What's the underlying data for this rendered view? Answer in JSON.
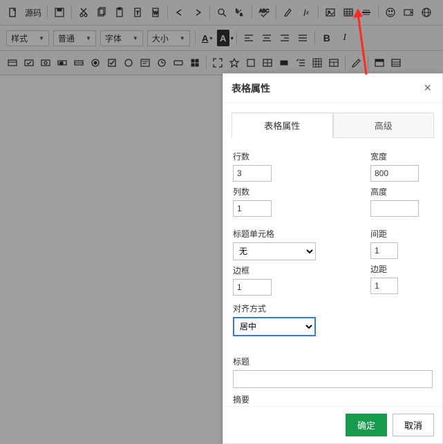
{
  "toolbar": {
    "source_label": "源码",
    "style_label": "样式",
    "format_label": "普通",
    "font_label": "字体",
    "size_label": "大小",
    "text_color": "A",
    "bg_color": "A",
    "bold": "B",
    "italic": "I"
  },
  "modal": {
    "title": "表格属性",
    "tabs": {
      "main": "表格属性",
      "advanced": "高级"
    },
    "labels": {
      "rows": "行数",
      "cols": "列数",
      "width": "宽度",
      "height": "高度",
      "header_cells": "标题单元格",
      "border": "边框",
      "cell_spacing": "间距",
      "cell_padding": "边距",
      "align": "对齐方式",
      "caption": "标题",
      "summary": "摘要"
    },
    "values": {
      "rows": "3",
      "cols": "1",
      "width": "800",
      "height": "",
      "header_cells": "无",
      "border": "1",
      "cell_spacing": "1",
      "cell_padding": "1",
      "align": "居中",
      "caption": "",
      "summary": ""
    },
    "buttons": {
      "ok": "确定",
      "cancel": "取消"
    }
  }
}
